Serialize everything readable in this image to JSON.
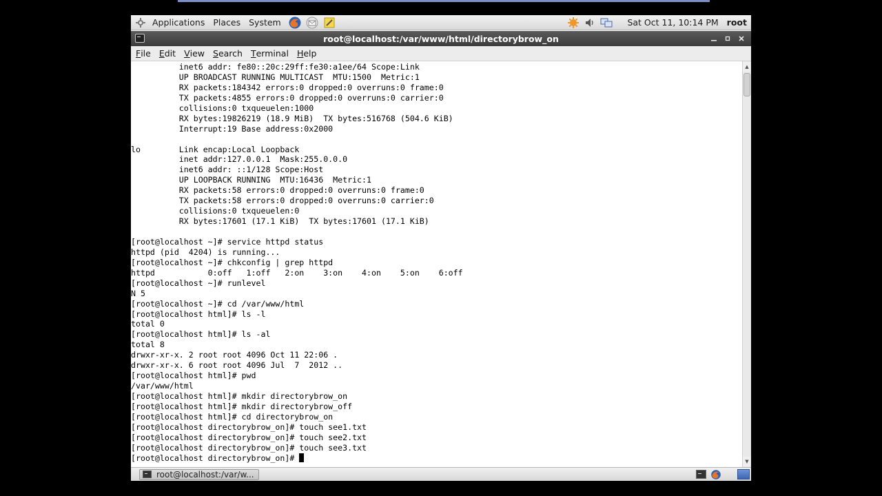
{
  "top_panel": {
    "menus": [
      "Applications",
      "Places",
      "System"
    ],
    "launchers": [
      {
        "name": "firefox-icon",
        "label": "Firefox"
      },
      {
        "name": "evolution-icon",
        "label": "Mail"
      },
      {
        "name": "notes-icon",
        "label": "Notes"
      }
    ],
    "tray": [
      {
        "name": "updates-icon"
      },
      {
        "name": "volume-icon"
      },
      {
        "name": "network-icon"
      }
    ],
    "clock": "Sat Oct 11, 10:14 PM",
    "user": "root"
  },
  "window": {
    "title": "root@localhost:/var/www/html/directorybrow_on",
    "controls": [
      "minimize",
      "maximize",
      "close"
    ]
  },
  "menubar": {
    "items": [
      {
        "pre": "",
        "ul": "F",
        "post": "ile"
      },
      {
        "pre": "",
        "ul": "E",
        "post": "dit"
      },
      {
        "pre": "",
        "ul": "V",
        "post": "iew"
      },
      {
        "pre": "",
        "ul": "S",
        "post": "earch"
      },
      {
        "pre": "",
        "ul": "T",
        "post": "erminal"
      },
      {
        "pre": "",
        "ul": "H",
        "post": "elp"
      }
    ]
  },
  "terminal": {
    "lines": [
      "          inet6 addr: fe80::20c:29ff:fe30:a1ee/64 Scope:Link",
      "          UP BROADCAST RUNNING MULTICAST  MTU:1500  Metric:1",
      "          RX packets:184342 errors:0 dropped:0 overruns:0 frame:0",
      "          TX packets:4855 errors:0 dropped:0 overruns:0 carrier:0",
      "          collisions:0 txqueuelen:1000",
      "          RX bytes:19826219 (18.9 MiB)  TX bytes:516768 (504.6 KiB)",
      "          Interrupt:19 Base address:0x2000",
      "",
      "lo        Link encap:Local Loopback",
      "          inet addr:127.0.0.1  Mask:255.0.0.0",
      "          inet6 addr: ::1/128 Scope:Host",
      "          UP LOOPBACK RUNNING  MTU:16436  Metric:1",
      "          RX packets:58 errors:0 dropped:0 overruns:0 frame:0",
      "          TX packets:58 errors:0 dropped:0 overruns:0 carrier:0",
      "          collisions:0 txqueuelen:0",
      "          RX bytes:17601 (17.1 KiB)  TX bytes:17601 (17.1 KiB)",
      "",
      "[root@localhost ~]# service httpd status",
      "httpd (pid  4204) is running...",
      "[root@localhost ~]# chkconfig | grep httpd",
      "httpd           0:off   1:off   2:on    3:on    4:on    5:on    6:off",
      "[root@localhost ~]# runlevel",
      "N 5",
      "[root@localhost ~]# cd /var/www/html",
      "[root@localhost html]# ls -l",
      "total 0",
      "[root@localhost html]# ls -al",
      "total 8",
      "drwxr-xr-x. 2 root root 4096 Oct 11 22:06 .",
      "drwxr-xr-x. 6 root root 4096 Jul  7  2012 ..",
      "[root@localhost html]# pwd",
      "/var/www/html",
      "[root@localhost html]# mkdir directorybrow_on",
      "[root@localhost html]# mkdir directorybrow_off",
      "[root@localhost html]# cd directorybrow_on",
      "[root@localhost directorybrow_on]# touch see1.txt",
      "[root@localhost directorybrow_on]# touch see2.txt",
      "[root@localhost directorybrow_on]# touch see3.txt",
      "[root@localhost directorybrow_on]# "
    ]
  },
  "bottom_panel": {
    "task_label": "root@localhost:/var/w..."
  }
}
